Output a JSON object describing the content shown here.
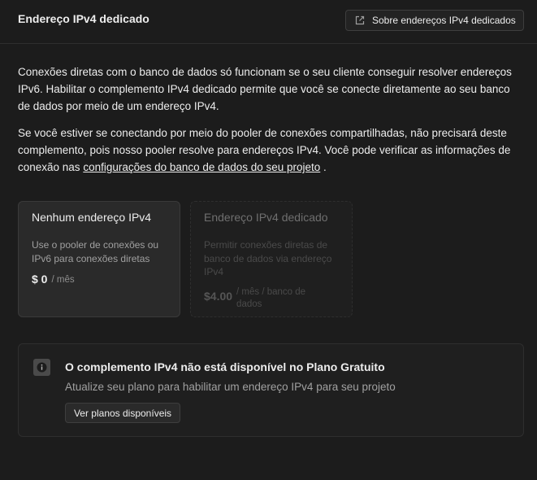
{
  "header": {
    "title": "Endereço IPv4 dedicado",
    "about_button": "Sobre endereços IPv4 dedicados",
    "about_icon": "external-link-icon"
  },
  "description": {
    "p1": "Conexões diretas com o banco de dados só funcionam se o seu cliente conseguir resolver endereços IPv6. Habilitar o complemento IPv4 dedicado permite que você se conecte diretamente ao seu banco de dados por meio de um endereço IPv4.",
    "p2_before": "Se você estiver se conectando por meio do pooler de conexões compartilhadas, não precisará deste complemento, pois nosso pooler resolve para endereços IPv4. Você pode verificar as informações de conexão nas ",
    "p2_link": "configurações do banco de dados do seu projeto",
    "p2_after": " ."
  },
  "options": [
    {
      "title": "Nenhum endereço IPv4",
      "description": "Use o pooler de conexões ou IPv6 para conexões diretas",
      "price": "$ 0",
      "unit": "/ mês",
      "selected": true
    },
    {
      "title": "Endereço IPv4 dedicado",
      "description": "Permitir conexões diretas de banco de dados via endereço IPv4",
      "price": "$4.00",
      "unit": "/ mês / banco de dados",
      "selected": false
    }
  ],
  "notice": {
    "icon": "info-icon",
    "title": "O complemento IPv4 não está disponível no Plano Gratuito",
    "text": "Atualize seu plano para habilitar um endereço IPv4 para seu projeto",
    "button": "Ver planos disponíveis"
  }
}
